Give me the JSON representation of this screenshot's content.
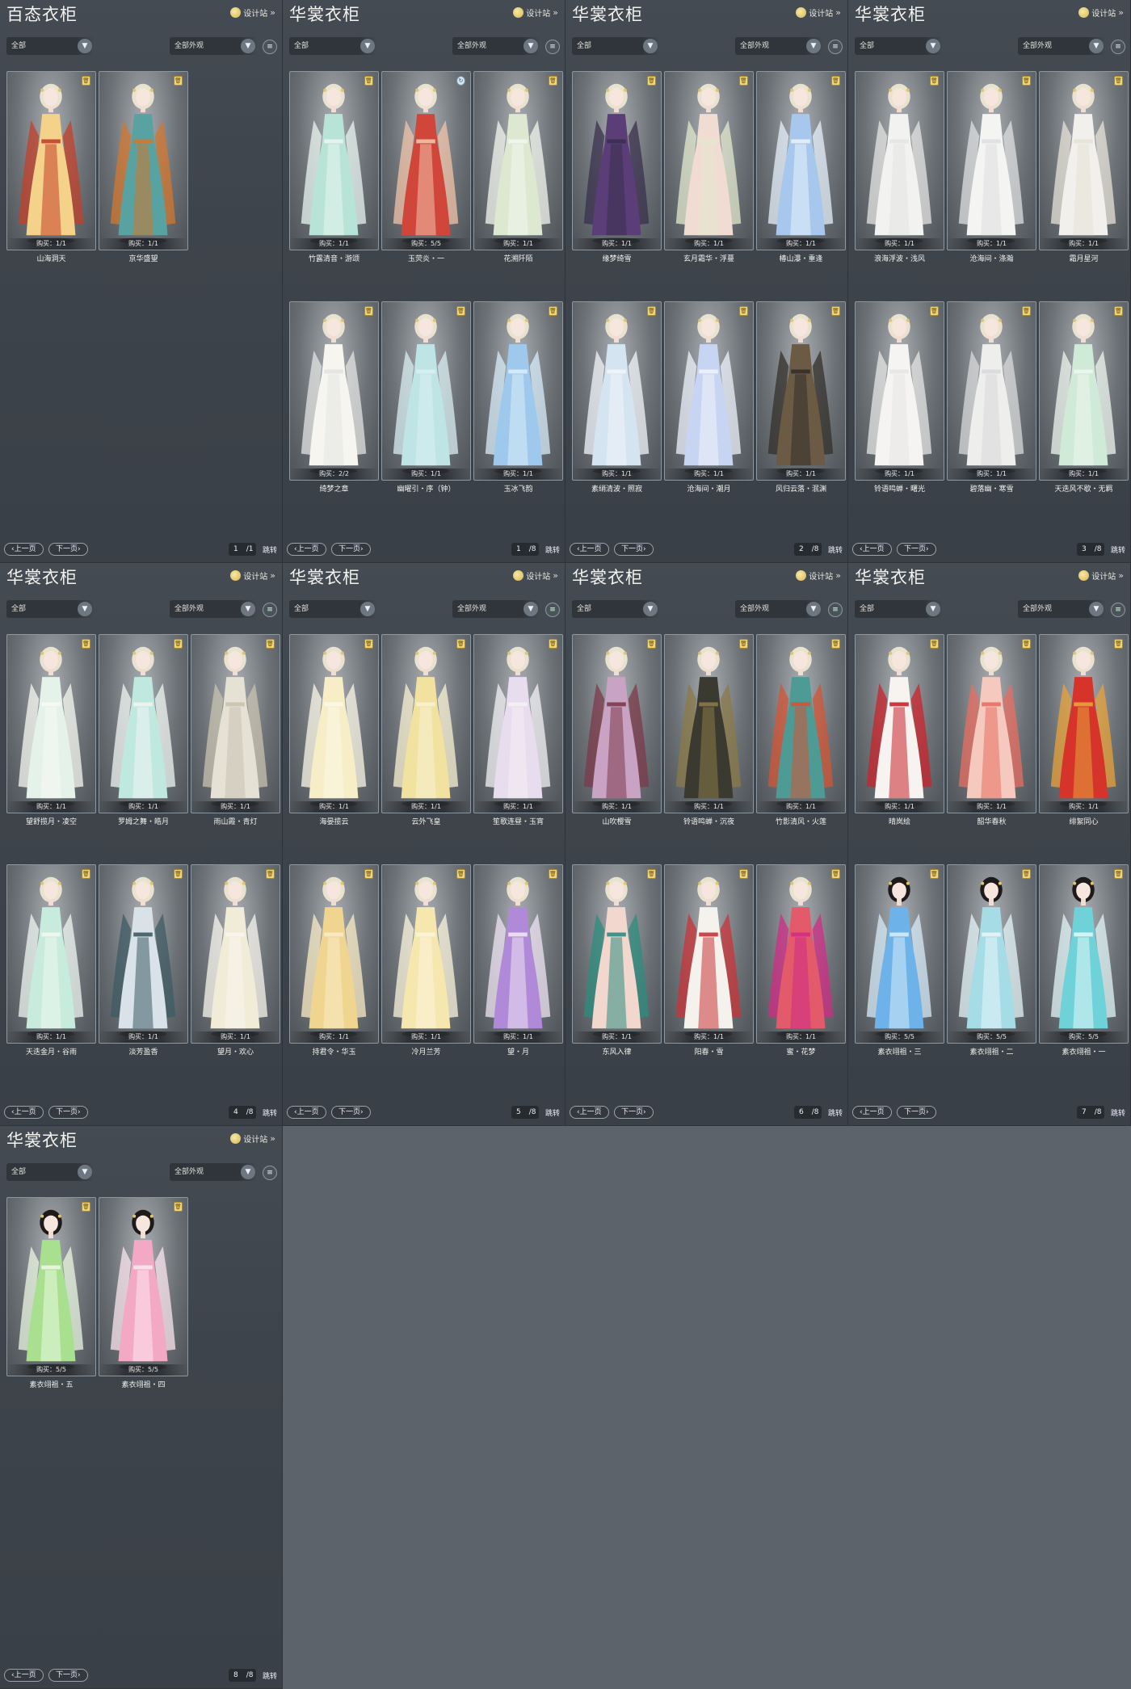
{
  "labels": {
    "design": "设计站",
    "dropdown_all": "全部",
    "dropdown_appearance": "全部外观",
    "prev": "上一页",
    "next": "下一页",
    "jump": "跳转",
    "filter_icon": "filter-list-icon"
  },
  "panels": [
    {
      "title": "百态衣柜",
      "page": "1",
      "total": "/1",
      "cards": [
        {
          "name": "山海洞天",
          "buy": "购买：1/1",
          "palette": [
            "#f5d28a",
            "#c2402b"
          ]
        },
        {
          "name": "京华盛望",
          "buy": "购买：1/1",
          "palette": [
            "#58a3a1",
            "#d1772f"
          ]
        }
      ]
    },
    {
      "title": "华裳衣柜",
      "page": "1",
      "total": "/8",
      "cards": [
        {
          "name": "竹露清音・游颂",
          "buy": "购买：1/1",
          "palette": [
            "#b7e4d7",
            "#e8f4ef"
          ]
        },
        {
          "name": "玉荧炎・一",
          "buy": "购买：5/5",
          "palette": [
            "#d0463b",
            "#f1c3a9"
          ],
          "swap": true
        },
        {
          "name": "花溯阡陌",
          "buy": "购买：1/1",
          "palette": [
            "#dce8d0",
            "#f3f5ee"
          ]
        },
        {
          "name": "绮梦之章",
          "buy": "购买：2/2",
          "palette": [
            "#f6f5f0",
            "#e3e3e2"
          ]
        },
        {
          "name": "幽曜引・序（钟）",
          "buy": "购买：1/1",
          "palette": [
            "#bfe4e6",
            "#d8eef1"
          ]
        },
        {
          "name": "玉冰飞韵",
          "buy": "购买：1/1",
          "palette": [
            "#9fc9ec",
            "#d8ecf8"
          ]
        }
      ]
    },
    {
      "title": "华裳衣柜",
      "page": "2",
      "total": "/8",
      "cards": [
        {
          "name": "缘梦绮雪",
          "buy": "购买：1/1",
          "palette": [
            "#5b3e78",
            "#39304e"
          ]
        },
        {
          "name": "玄月霜华・浮蔓",
          "buy": "购买：1/1",
          "palette": [
            "#f1dcd3",
            "#e1e8cd"
          ]
        },
        {
          "name": "椿山瀑・重逢",
          "buy": "购买：1/1",
          "palette": [
            "#a8c7ec",
            "#e6f0fb"
          ]
        },
        {
          "name": "素绡清波・照寂",
          "buy": "购买：1/1",
          "palette": [
            "#d4e4f1",
            "#f1f4f8"
          ]
        },
        {
          "name": "沧海间・潮月",
          "buy": "购买：1/1",
          "palette": [
            "#c7d5f2",
            "#eef2fb"
          ]
        },
        {
          "name": "风归云落・泯渊",
          "buy": "购买：1/1",
          "palette": [
            "#6b5a44",
            "#33302b"
          ]
        }
      ]
    },
    {
      "title": "华裳衣柜",
      "page": "3",
      "total": "/8",
      "cards": [
        {
          "name": "浪海浮波・浅风",
          "buy": "购买：1/1",
          "palette": [
            "#f2f2f0",
            "#e4e4e2"
          ]
        },
        {
          "name": "沧海间・涤瀚",
          "buy": "购买：1/1",
          "palette": [
            "#f4f4f3",
            "#dedfe0"
          ]
        },
        {
          "name": "霜月星河",
          "buy": "购买：1/1",
          "palette": [
            "#f1f0ec",
            "#e6e2d7"
          ]
        },
        {
          "name": "铃语鸣蝉・曙光",
          "buy": "购买：1/1",
          "palette": [
            "#f5f4f2",
            "#e5e5e4"
          ]
        },
        {
          "name": "碧落幽・寒雪",
          "buy": "购买：1/1",
          "palette": [
            "#eeeeed",
            "#d8d9da"
          ]
        },
        {
          "name": "天迭风不歇・无羁",
          "buy": "购买：1/1",
          "palette": [
            "#cfead6",
            "#eef6ef"
          ]
        }
      ]
    },
    {
      "title": "华裳衣柜",
      "page": "4",
      "total": "/8",
      "cards": [
        {
          "name": "望舒揽月・凌空",
          "buy": "购买：1/1",
          "palette": [
            "#e4f2ea",
            "#f7f8f2"
          ]
        },
        {
          "name": "罗姆之舞・皓月",
          "buy": "购买：1/1",
          "palette": [
            "#bfe8df",
            "#f0f4f0"
          ]
        },
        {
          "name": "雨山霞・青灯",
          "buy": "购买：1/1",
          "palette": [
            "#e5e1d5",
            "#c8c2b0"
          ]
        },
        {
          "name": "天迭金月・谷雨",
          "buy": "购买：1/1",
          "palette": [
            "#c7ebdc",
            "#eef7f1"
          ]
        },
        {
          "name": "淡芳盈香",
          "buy": "购买：1/1",
          "palette": [
            "#d9e2e8",
            "#3d5b64"
          ]
        },
        {
          "name": "望月・欢心",
          "buy": "购买：1/1",
          "palette": [
            "#f1ecd7",
            "#f8f6ee"
          ]
        }
      ]
    },
    {
      "title": "华裳衣柜",
      "page": "5",
      "total": "/8",
      "cards": [
        {
          "name": "海晏揽云",
          "buy": "购买：1/1",
          "palette": [
            "#f7edc7",
            "#fbf7e6"
          ]
        },
        {
          "name": "云外飞皇",
          "buy": "购买：1/1",
          "palette": [
            "#f2e2a0",
            "#f8f1d1"
          ]
        },
        {
          "name": "笙歌连昼・玉宵",
          "buy": "购买：1/1",
          "palette": [
            "#e8dcef",
            "#f3f1f4"
          ]
        },
        {
          "name": "持君令・华玉",
          "buy": "购买：1/1",
          "palette": [
            "#f0d590",
            "#f8ebc5"
          ]
        },
        {
          "name": "冷月兰芳",
          "buy": "购买：1/1",
          "palette": [
            "#f5e7ae",
            "#fbf4dc"
          ]
        },
        {
          "name": "望・月",
          "buy": "购买：1/1",
          "palette": [
            "#b08ad8",
            "#efe4f3"
          ]
        }
      ]
    },
    {
      "title": "华裳衣柜",
      "page": "6",
      "total": "/8",
      "cards": [
        {
          "name": "山吹樱雪",
          "buy": "购买：1/1",
          "palette": [
            "#c9a3c4",
            "#7b3a4a"
          ]
        },
        {
          "name": "铃语鸣蝉・沉夜",
          "buy": "购买：1/1",
          "palette": [
            "#3a3a30",
            "#8b7a48"
          ]
        },
        {
          "name": "竹影清风・火莲",
          "buy": "购买：1/1",
          "palette": [
            "#4e9a95",
            "#d35535"
          ]
        },
        {
          "name": "东风入律",
          "buy": "购买：1/1",
          "palette": [
            "#f2d7cf",
            "#2e8c7e"
          ]
        },
        {
          "name": "阳春・雪",
          "buy": "购买：1/1",
          "palette": [
            "#f5f2ee",
            "#c8343a"
          ]
        },
        {
          "name": "蜜・花梦",
          "buy": "购买：1/1",
          "palette": [
            "#e35a6a",
            "#d02c86"
          ]
        }
      ]
    },
    {
      "title": "华裳衣柜",
      "page": "7",
      "total": "/8",
      "cards": [
        {
          "name": "晴岚绘",
          "buy": "购买：1/1",
          "palette": [
            "#f6f3f1",
            "#c9232b"
          ]
        },
        {
          "name": "韶华春秋",
          "buy": "购买：1/1",
          "palette": [
            "#f5c9bd",
            "#e86e62"
          ]
        },
        {
          "name": "绯絮同心",
          "buy": "购买：1/1",
          "palette": [
            "#d6332b",
            "#e8a23a"
          ]
        },
        {
          "name": "素衣翊祖・三",
          "buy": "购买：5/5",
          "palette": [
            "#6db2e8",
            "#d7ebf8"
          ],
          "dark": true
        },
        {
          "name": "素衣翊祖・二",
          "buy": "购买：5/5",
          "palette": [
            "#a6dce6",
            "#e6f5f8"
          ],
          "dark": true
        },
        {
          "name": "素衣翊祖・一",
          "buy": "购买：5/5",
          "palette": [
            "#6fd2d8",
            "#e1f6f7"
          ],
          "dark": true
        }
      ]
    },
    {
      "title": "华裳衣柜",
      "page": "8",
      "total": "/8",
      "cards": [
        {
          "name": "素衣翊祖・五",
          "buy": "购买：5/5",
          "palette": [
            "#a8e08f",
            "#eaf7e2"
          ],
          "dark": true
        },
        {
          "name": "素衣翊祖・四",
          "buy": "购买：5/5",
          "palette": [
            "#f3a9c4",
            "#fbe6ee"
          ],
          "dark": true
        }
      ]
    }
  ]
}
